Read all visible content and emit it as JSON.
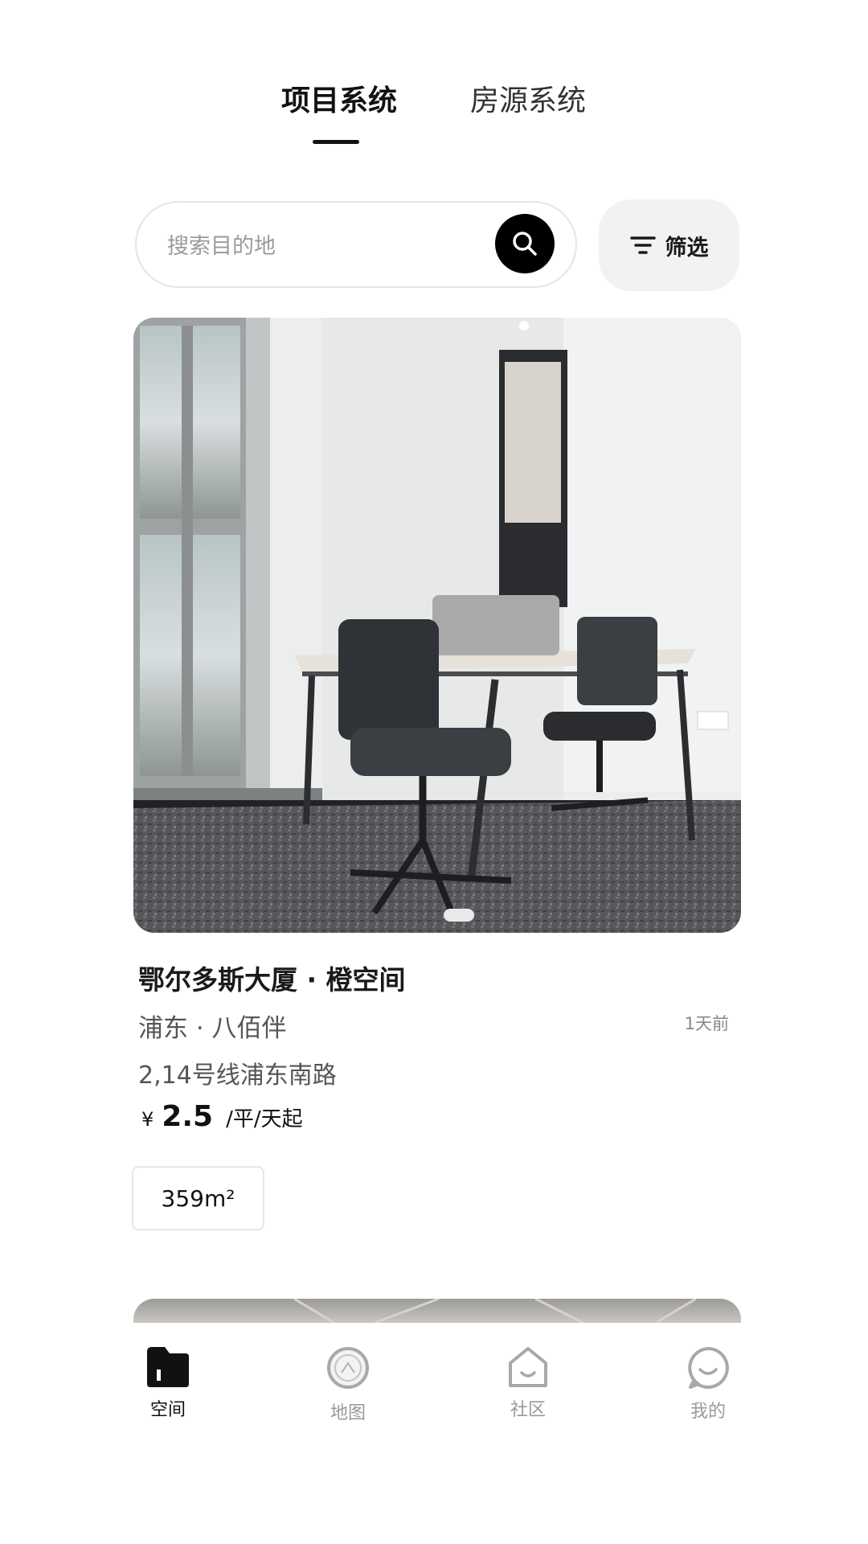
{
  "tabs": [
    {
      "label": "项目系统",
      "active": true
    },
    {
      "label": "房源系统",
      "active": false
    }
  ],
  "search": {
    "placeholder": "搜索目的地",
    "value": ""
  },
  "filter": {
    "label": "筛选"
  },
  "listing": {
    "title": "鄂尔多斯大厦 · 橙空间",
    "area": "浦东 · 八佰伴",
    "time": "1天前",
    "metro": "2,14号线浦东南路",
    "price": {
      "currency": "¥",
      "value": "2.5",
      "unit": "/平/天起"
    },
    "tags": [
      "359m²"
    ]
  },
  "bottom_nav": [
    {
      "label": "空间",
      "icon": "space-folder-icon",
      "active": true
    },
    {
      "label": "地图",
      "icon": "map-icon",
      "active": false
    },
    {
      "label": "社区",
      "icon": "community-house-icon",
      "active": false
    },
    {
      "label": "我的",
      "icon": "profile-face-icon",
      "active": false
    }
  ],
  "colors": {
    "accent": "#000000",
    "inactive": "#999999",
    "background": "#ffffff"
  }
}
